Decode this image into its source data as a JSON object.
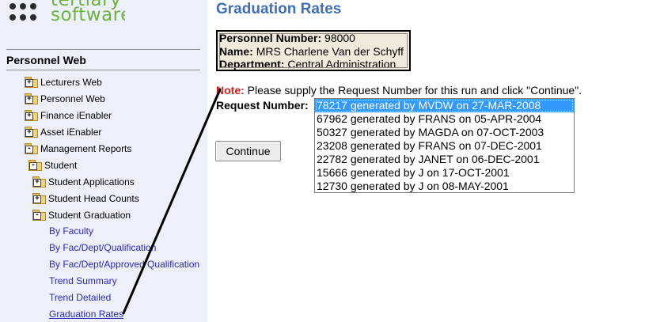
{
  "logo": {
    "line1": "tertiary",
    "line2": "software"
  },
  "sidebar": {
    "header": "Personnel Web",
    "items": [
      {
        "label": "Lecturers Web",
        "state": "+"
      },
      {
        "label": "Personnel Web",
        "state": "+"
      },
      {
        "label": "Finance iEnabler",
        "state": "+"
      },
      {
        "label": "Asset iEnabler",
        "state": "+"
      },
      {
        "label": "Management Reports",
        "state": "-"
      },
      {
        "label": "Student",
        "state": "-"
      },
      {
        "label": "Student Applications",
        "state": "+"
      },
      {
        "label": "Student Head Counts",
        "state": "+"
      },
      {
        "label": "Student Graduation",
        "state": "-"
      }
    ],
    "links": [
      "By Faculty",
      "By Fac/Dept/Qualification",
      "By Fac/Dept/Approved Qualification",
      "Trend Summary",
      "Trend Detailed",
      "Graduation Rates"
    ],
    "active_link": "Graduation Rates"
  },
  "main": {
    "title": "Graduation Rates",
    "personnel": {
      "number_label": "Personnel Number:",
      "number_value": "98000",
      "name_label": "Name:",
      "name_value": "MRS Charlene Van der Schyff",
      "department_label": "Department:",
      "department_value": "Central Administration"
    },
    "note_label": "Note:",
    "note_text": "Please supply the Request Number for this run and click \"Continue\".",
    "request_label": "Request Number:",
    "request_options": [
      "78217 generated by MVDW on 27-MAR-2008",
      "67962 generated by FRANS on 05-APR-2004",
      "50327 generated by MAGDA on 07-OCT-2003",
      "23208 generated by FRANS on 07-DEC-2001",
      "22782 generated by JANET on 06-DEC-2001",
      "15666 generated by J on 17-OCT-2001",
      "12730 generated by J on 08-MAY-2001"
    ],
    "selected_option": "78217 generated by MVDW on 27-MAR-2008",
    "continue_label": "Continue"
  },
  "colors": {
    "title": "#3e6fb8",
    "note": "#d22020",
    "link": "#2a2ab4",
    "selection": "#3399ff",
    "sidebar_bg": "#eef0f9",
    "logo_green": "#6cb33f"
  }
}
